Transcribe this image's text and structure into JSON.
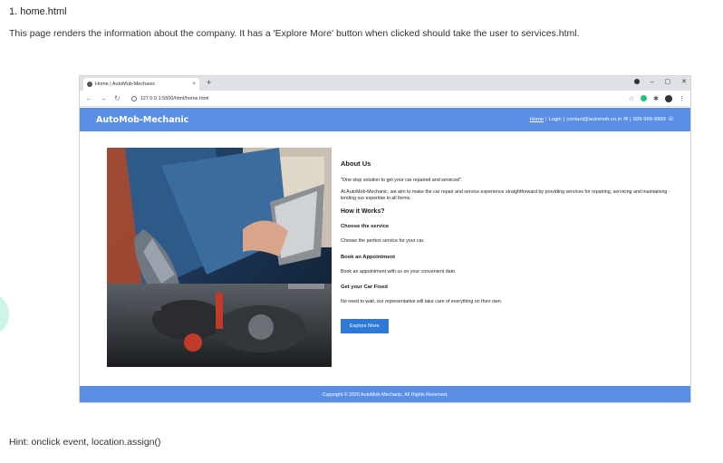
{
  "doc": {
    "heading": "1. home.html",
    "description": "This page renders the information about the company. It has a 'Explore More' button when clicked should take the user to services.html.",
    "hint": "Hint: onclick event, location.assign()"
  },
  "browser": {
    "tab_title": "Home | AutoMob-Mechanic",
    "tab_close": "×",
    "new_tab": "+",
    "url": "127.0.0.1:5500/html/home.html",
    "window_controls": [
      "–",
      "▢",
      "✕"
    ]
  },
  "site": {
    "brand": "AutoMob-Mechanic",
    "nav": {
      "home": "Home",
      "login": "Login",
      "contact": "contact@automob.co.in",
      "phone": "999-999-9999",
      "sep": "|"
    },
    "about_heading": "About Us",
    "tagline": "\"One stop solution to get your car repaired and serviced\".",
    "about_text": "At AutoMob-Mechanic, we aim to make the car repair and service experience straightforward by providing services for repairing, servicing and maintaining - lending our expertise in all forms.",
    "how_heading": "How it Works?",
    "steps": [
      {
        "title": "Choose the service",
        "text": "Choose the perfect service for your car."
      },
      {
        "title": "Book an Appointment",
        "text": "Book an appointment with us on your convenient date."
      },
      {
        "title": "Get your Car Fixed",
        "text": "No need to wait, our representative will take care of everything on their own."
      }
    ],
    "explore_button": "Explore More",
    "footer": "Copyright © 2020 AutoMob-Mechanic.  All Rights Reserved."
  },
  "colors": {
    "nav_bar": "#5b8fe6",
    "button": "#2f78d6",
    "tab_strip": "#dee1e6"
  }
}
